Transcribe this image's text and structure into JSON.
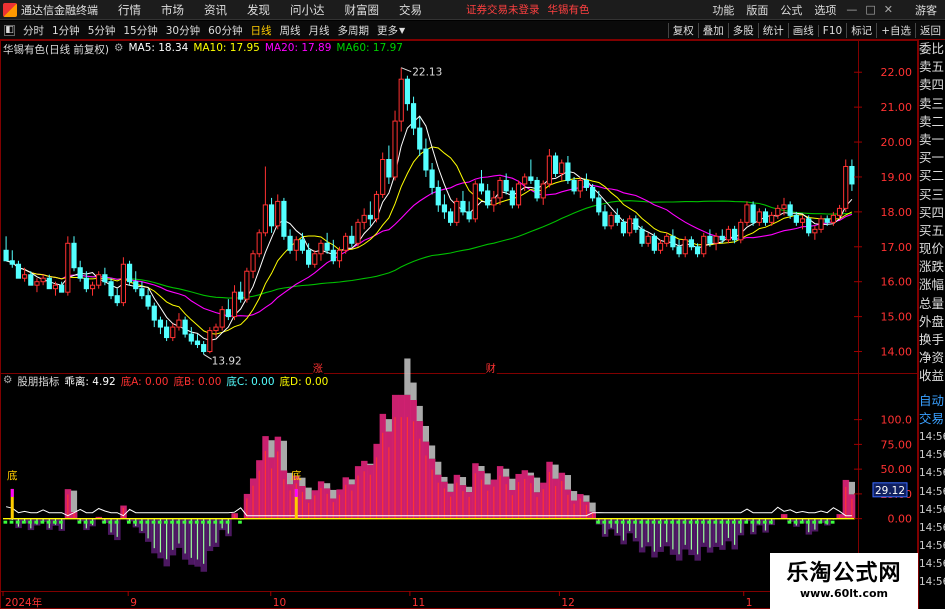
{
  "app": {
    "title": "通达信金融终端",
    "logo_icon": "tdx-logo-icon"
  },
  "menu": [
    "行情",
    "市场",
    "资讯",
    "发现",
    "问小达",
    "财富圈",
    "交易"
  ],
  "login_status": "证券交易未登录",
  "stock_badge": "华锡有色",
  "right_menu": [
    "功能",
    "版面",
    "公式",
    "选项"
  ],
  "guest_label": "游客",
  "toolbar": {
    "left": [
      "分时",
      "1分钟",
      "5分钟",
      "15分钟",
      "30分钟",
      "60分钟",
      "日线",
      "周线",
      "月线",
      "多周期",
      "更多"
    ],
    "active": "日线",
    "right": [
      "复权",
      "叠加",
      "多股",
      "统计",
      "画线",
      "F10",
      "标记",
      "+自选",
      "返回"
    ]
  },
  "main_legend": {
    "title": "华锡有色(日线 前复权)",
    "ma5": "MA5: 18.34",
    "ma10": "MA10: 17.95",
    "ma20": "MA20: 17.89",
    "ma60": "MA60: 17.97"
  },
  "sub_legend": {
    "title": "股朋指标",
    "qiaoli": "乖离: 4.92",
    "da": "底A: 0.00",
    "db": "底B: 0.00",
    "dc": "底C: 0.00",
    "dd": "底D: 0.00"
  },
  "colors": {
    "up": "#ff3232",
    "down": "#54ffff",
    "ma5": "#ffffff",
    "ma10": "#ffff00",
    "ma20": "#ff00ff",
    "ma60": "#00c000",
    "grid": "#800000"
  },
  "price_axis": [
    "22.00",
    "21.00",
    "20.00",
    "19.00",
    "18.00",
    "17.00",
    "16.00",
    "15.00",
    "14.00"
  ],
  "price_range": [
    13.7,
    22.35
  ],
  "high_label": "22.13",
  "low_label": "13.92",
  "event_marks": [
    "涨",
    "财",
    "预"
  ],
  "sub_axis": [
    "100.0",
    "75.00",
    "50.00",
    "25.00",
    "0.00"
  ],
  "sub_axis_range": [
    -70,
    140
  ],
  "sub_current_value": "29.12",
  "di_label": "底",
  "date_axis": [
    "2024年",
    "9",
    "10",
    "11",
    "12",
    "1",
    "2"
  ],
  "side_panel": {
    "quote_labels": [
      "委比",
      "卖五",
      "卖四",
      "卖三",
      "卖二",
      "卖一",
      "买一",
      "买二",
      "买三",
      "买四",
      "买五",
      "现价",
      "涨跌",
      "涨幅",
      "总量",
      "外盘",
      "换手",
      "净资",
      "收益"
    ],
    "trade_labels": [
      "自动",
      "交易"
    ],
    "times": [
      "14:56",
      "14:56",
      "14:56",
      "14:56",
      "14:56",
      "14:56",
      "14:56",
      "14:56",
      "14:56"
    ]
  },
  "watermark": {
    "title": "乐淘公式网",
    "url": "www.60lt.com"
  },
  "chart_data": [
    {
      "type": "candlestick",
      "title": "华锡有色(日线 前复权)",
      "ylim": [
        13.7,
        22.35
      ],
      "high": 22.13,
      "low": 13.92,
      "ohlc": [
        [
          16.9,
          17.3,
          16.7,
          16.6
        ],
        [
          16.6,
          16.9,
          16.4,
          16.5
        ],
        [
          16.5,
          16.6,
          16.2,
          16.1
        ],
        [
          16.1,
          16.4,
          16.0,
          16.2
        ],
        [
          16.2,
          16.3,
          15.9,
          15.9
        ],
        [
          15.9,
          16.1,
          15.7,
          16.0
        ],
        [
          16.0,
          16.2,
          15.9,
          16.1
        ],
        [
          16.1,
          16.2,
          15.8,
          15.8
        ],
        [
          15.8,
          16.0,
          15.6,
          15.9
        ],
        [
          15.9,
          16.0,
          15.7,
          15.7
        ],
        [
          15.7,
          17.3,
          15.6,
          17.1
        ],
        [
          17.1,
          17.3,
          16.3,
          16.4
        ],
        [
          16.4,
          16.6,
          16.0,
          16.1
        ],
        [
          16.1,
          16.3,
          15.7,
          15.8
        ],
        [
          15.8,
          16.0,
          15.6,
          15.9
        ],
        [
          15.9,
          16.3,
          15.8,
          16.2
        ],
        [
          16.2,
          16.4,
          15.9,
          16.0
        ],
        [
          16.0,
          16.1,
          15.5,
          15.6
        ],
        [
          15.6,
          15.8,
          15.3,
          15.4
        ],
        [
          15.4,
          16.7,
          15.3,
          16.5
        ],
        [
          16.5,
          16.6,
          15.9,
          16.0
        ],
        [
          16.0,
          16.3,
          15.7,
          15.8
        ],
        [
          15.8,
          16.0,
          15.5,
          15.6
        ],
        [
          15.6,
          15.8,
          15.2,
          15.3
        ],
        [
          15.3,
          15.4,
          14.7,
          14.9
        ],
        [
          14.9,
          15.0,
          14.5,
          14.7
        ],
        [
          14.7,
          14.9,
          14.3,
          14.4
        ],
        [
          14.4,
          14.8,
          14.3,
          14.7
        ],
        [
          14.7,
          15.1,
          14.6,
          14.9
        ],
        [
          14.9,
          15.0,
          14.4,
          14.5
        ],
        [
          14.5,
          14.7,
          14.2,
          14.3
        ],
        [
          14.3,
          14.5,
          14.1,
          14.2
        ],
        [
          14.2,
          14.3,
          13.92,
          14.0
        ],
        [
          14.0,
          14.7,
          13.95,
          14.6
        ],
        [
          14.6,
          14.8,
          14.4,
          14.7
        ],
        [
          14.7,
          15.3,
          14.6,
          15.2
        ],
        [
          15.2,
          15.5,
          14.9,
          15.0
        ],
        [
          15.0,
          15.9,
          14.9,
          15.7
        ],
        [
          15.7,
          16.0,
          15.4,
          15.5
        ],
        [
          15.5,
          16.4,
          15.4,
          16.3
        ],
        [
          16.3,
          16.9,
          16.1,
          16.8
        ],
        [
          16.8,
          17.5,
          16.7,
          17.4
        ],
        [
          17.4,
          19.3,
          17.3,
          18.2
        ],
        [
          18.2,
          18.4,
          17.4,
          17.6
        ],
        [
          17.6,
          18.5,
          17.5,
          18.3
        ],
        [
          18.3,
          18.4,
          17.2,
          17.3
        ],
        [
          17.3,
          17.5,
          16.8,
          16.9
        ],
        [
          16.9,
          17.3,
          16.6,
          17.2
        ],
        [
          17.2,
          17.4,
          16.8,
          16.9
        ],
        [
          16.9,
          17.1,
          16.4,
          16.5
        ],
        [
          16.5,
          16.9,
          16.4,
          16.8
        ],
        [
          16.8,
          17.2,
          16.6,
          17.1
        ],
        [
          17.1,
          17.4,
          16.8,
          16.9
        ],
        [
          16.9,
          17.2,
          16.5,
          16.6
        ],
        [
          16.6,
          17.0,
          16.4,
          16.9
        ],
        [
          16.9,
          17.4,
          16.8,
          17.3
        ],
        [
          17.3,
          17.6,
          17.0,
          17.1
        ],
        [
          17.1,
          17.8,
          17.0,
          17.7
        ],
        [
          17.7,
          18.1,
          17.5,
          17.9
        ],
        [
          17.9,
          18.3,
          17.6,
          17.8
        ],
        [
          17.8,
          18.6,
          17.7,
          18.5
        ],
        [
          18.5,
          19.7,
          18.4,
          19.5
        ],
        [
          19.5,
          19.9,
          18.8,
          19.0
        ],
        [
          19.0,
          20.9,
          18.9,
          20.6
        ],
        [
          20.6,
          22.13,
          20.3,
          21.8
        ],
        [
          21.8,
          21.9,
          20.9,
          21.1
        ],
        [
          21.1,
          21.3,
          20.2,
          20.4
        ],
        [
          20.4,
          20.7,
          19.6,
          19.8
        ],
        [
          19.8,
          20.1,
          19.0,
          19.2
        ],
        [
          19.2,
          19.4,
          18.5,
          18.7
        ],
        [
          18.7,
          18.9,
          18.0,
          18.2
        ],
        [
          18.2,
          18.5,
          17.8,
          18.0
        ],
        [
          18.0,
          18.1,
          17.6,
          17.7
        ],
        [
          17.7,
          18.4,
          17.6,
          18.3
        ],
        [
          18.3,
          18.6,
          17.9,
          18.0
        ],
        [
          18.0,
          18.3,
          17.7,
          17.8
        ],
        [
          17.8,
          18.9,
          17.7,
          18.8
        ],
        [
          18.8,
          19.2,
          18.5,
          18.6
        ],
        [
          18.6,
          18.8,
          18.1,
          18.2
        ],
        [
          18.2,
          18.6,
          18.0,
          18.4
        ],
        [
          18.4,
          19.0,
          18.2,
          18.9
        ],
        [
          18.9,
          19.1,
          18.5,
          18.6
        ],
        [
          18.6,
          18.7,
          18.1,
          18.2
        ],
        [
          18.2,
          18.9,
          18.1,
          18.8
        ],
        [
          18.8,
          19.1,
          18.6,
          19.0
        ],
        [
          19.0,
          19.5,
          18.8,
          18.9
        ],
        [
          18.9,
          19.0,
          18.3,
          18.4
        ],
        [
          18.4,
          18.9,
          18.2,
          18.8
        ],
        [
          18.8,
          19.8,
          18.7,
          19.6
        ],
        [
          19.6,
          19.7,
          19.0,
          19.1
        ],
        [
          19.1,
          19.5,
          18.9,
          19.4
        ],
        [
          19.4,
          19.6,
          18.8,
          18.9
        ],
        [
          18.9,
          19.0,
          18.5,
          18.6
        ],
        [
          18.6,
          19.0,
          18.4,
          18.9
        ],
        [
          18.9,
          19.1,
          18.6,
          18.7
        ],
        [
          18.7,
          18.8,
          18.3,
          18.4
        ],
        [
          18.4,
          18.6,
          17.9,
          18.0
        ],
        [
          18.0,
          18.2,
          17.5,
          17.6
        ],
        [
          17.6,
          18.0,
          17.5,
          17.9
        ],
        [
          17.9,
          18.1,
          17.6,
          17.7
        ],
        [
          17.7,
          17.8,
          17.3,
          17.4
        ],
        [
          17.4,
          17.9,
          17.3,
          17.8
        ],
        [
          17.8,
          17.9,
          17.4,
          17.5
        ],
        [
          17.5,
          17.6,
          17.0,
          17.1
        ],
        [
          17.1,
          17.4,
          17.0,
          17.3
        ],
        [
          17.3,
          17.4,
          16.8,
          16.9
        ],
        [
          16.9,
          17.2,
          16.8,
          17.1
        ],
        [
          17.1,
          17.4,
          17.0,
          17.3
        ],
        [
          17.3,
          17.5,
          16.9,
          17.0
        ],
        [
          17.0,
          17.2,
          16.7,
          16.8
        ],
        [
          16.8,
          17.3,
          16.7,
          17.2
        ],
        [
          17.2,
          17.3,
          16.9,
          17.0
        ],
        [
          17.0,
          17.1,
          16.7,
          16.8
        ],
        [
          16.8,
          17.4,
          16.7,
          17.3
        ],
        [
          17.3,
          17.5,
          17.0,
          17.1
        ],
        [
          17.1,
          17.4,
          16.9,
          17.3
        ],
        [
          17.3,
          17.5,
          17.1,
          17.2
        ],
        [
          17.2,
          17.6,
          17.1,
          17.5
        ],
        [
          17.5,
          17.6,
          17.1,
          17.2
        ],
        [
          17.2,
          17.8,
          17.1,
          17.7
        ],
        [
          17.7,
          18.3,
          17.6,
          18.2
        ],
        [
          18.2,
          18.3,
          17.6,
          17.7
        ],
        [
          17.7,
          18.1,
          17.6,
          18.0
        ],
        [
          18.0,
          18.1,
          17.6,
          17.7
        ],
        [
          17.7,
          18.0,
          17.6,
          17.9
        ],
        [
          17.9,
          18.2,
          17.8,
          18.1
        ],
        [
          18.1,
          18.4,
          17.9,
          18.2
        ],
        [
          18.2,
          18.3,
          17.8,
          17.9
        ],
        [
          17.9,
          18.0,
          17.6,
          17.7
        ],
        [
          17.7,
          17.9,
          17.5,
          17.8
        ],
        [
          17.8,
          17.9,
          17.3,
          17.4
        ],
        [
          17.4,
          17.6,
          17.2,
          17.5
        ],
        [
          17.5,
          17.9,
          17.4,
          17.8
        ],
        [
          17.8,
          17.9,
          17.6,
          17.7
        ],
        [
          17.7,
          18.0,
          17.6,
          17.9
        ],
        [
          17.9,
          18.2,
          17.8,
          18.1
        ],
        [
          18.1,
          19.5,
          18.0,
          19.3
        ],
        [
          19.3,
          19.5,
          18.6,
          18.8
        ]
      ]
    },
    {
      "type": "bar",
      "title": "股朋指标",
      "ylim": [
        -70,
        140
      ],
      "current": 29.12,
      "di_signal_bars": [
        1,
        47,
        154,
        158,
        170
      ]
    }
  ]
}
